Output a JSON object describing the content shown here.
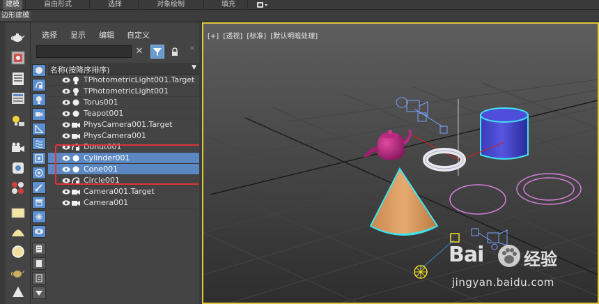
{
  "ribbon": {
    "tabs": [
      {
        "label": "建模",
        "active": true
      },
      {
        "label": "自由形式",
        "active": false
      },
      {
        "label": "选择",
        "active": false
      },
      {
        "label": "对象绘制",
        "active": false
      },
      {
        "label": "填充",
        "active": false
      }
    ]
  },
  "subbar": {
    "title": "边形建模"
  },
  "explorer": {
    "menu": [
      "选择",
      "显示",
      "编辑",
      "自定义"
    ],
    "search_value": "",
    "column_header": "名称(按降序排序)",
    "rows": [
      {
        "label": "TPhotometricLight001.Target",
        "type": "light",
        "selected": false
      },
      {
        "label": "TPhotometricLight001",
        "type": "light",
        "selected": false
      },
      {
        "label": "Torus001",
        "type": "geometry",
        "selected": false
      },
      {
        "label": "Teapot001",
        "type": "geometry",
        "selected": false
      },
      {
        "label": "PhysCamera001.Target",
        "type": "camera",
        "selected": false
      },
      {
        "label": "PhysCamera001",
        "type": "camera",
        "selected": false
      },
      {
        "label": "Donut001",
        "type": "shape",
        "selected": false
      },
      {
        "label": "Cylinder001",
        "type": "geometry",
        "selected": true
      },
      {
        "label": "Cone001",
        "type": "geometry",
        "selected": true
      },
      {
        "label": "Circle001",
        "type": "shape",
        "selected": false
      },
      {
        "label": "Camera001.Target",
        "type": "camera",
        "selected": false
      },
      {
        "label": "Camera001",
        "type": "camera",
        "selected": false
      }
    ]
  },
  "viewport": {
    "labels": [
      "[+]",
      "[透视]",
      "[标准]",
      "[默认明暗处理]"
    ]
  },
  "watermark": {
    "brand_a": "Bai",
    "brand_b": "经验",
    "url": "jingyan.baidu.com"
  },
  "colors": {
    "selection": "#5b88c2",
    "highlight_box": "#e2323a",
    "viewport_border": "#e3c63f",
    "panel": "#444444"
  }
}
